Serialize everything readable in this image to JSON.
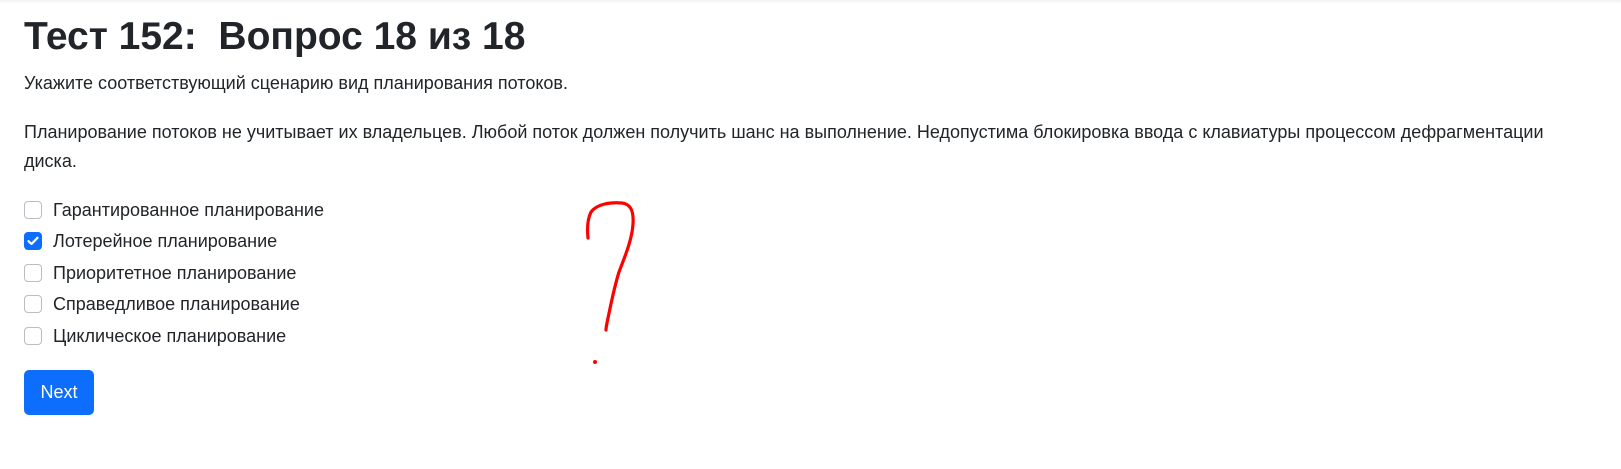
{
  "header": {
    "title": "Тест 152:  Вопрос 18 из 18"
  },
  "question": {
    "prompt": "Укажите соответствующий сценарию вид планирования потоков.",
    "scenario": "Планирование потоков не учитывает их владельцев. Любой поток должен получить шанс на выполнение. Недопустима блокировка ввода с клавиатуры процессом дефрагментации диска."
  },
  "options": [
    {
      "label": "Гарантированное планирование",
      "checked": false
    },
    {
      "label": "Лотерейное планирование",
      "checked": true
    },
    {
      "label": "Приоритетное планирование",
      "checked": false
    },
    {
      "label": "Справедливое планирование",
      "checked": false
    },
    {
      "label": "Циклическое планирование",
      "checked": false
    }
  ],
  "actions": {
    "next_label": "Next"
  },
  "colors": {
    "accent": "#0d6efd",
    "annotation": "#ff0000"
  }
}
